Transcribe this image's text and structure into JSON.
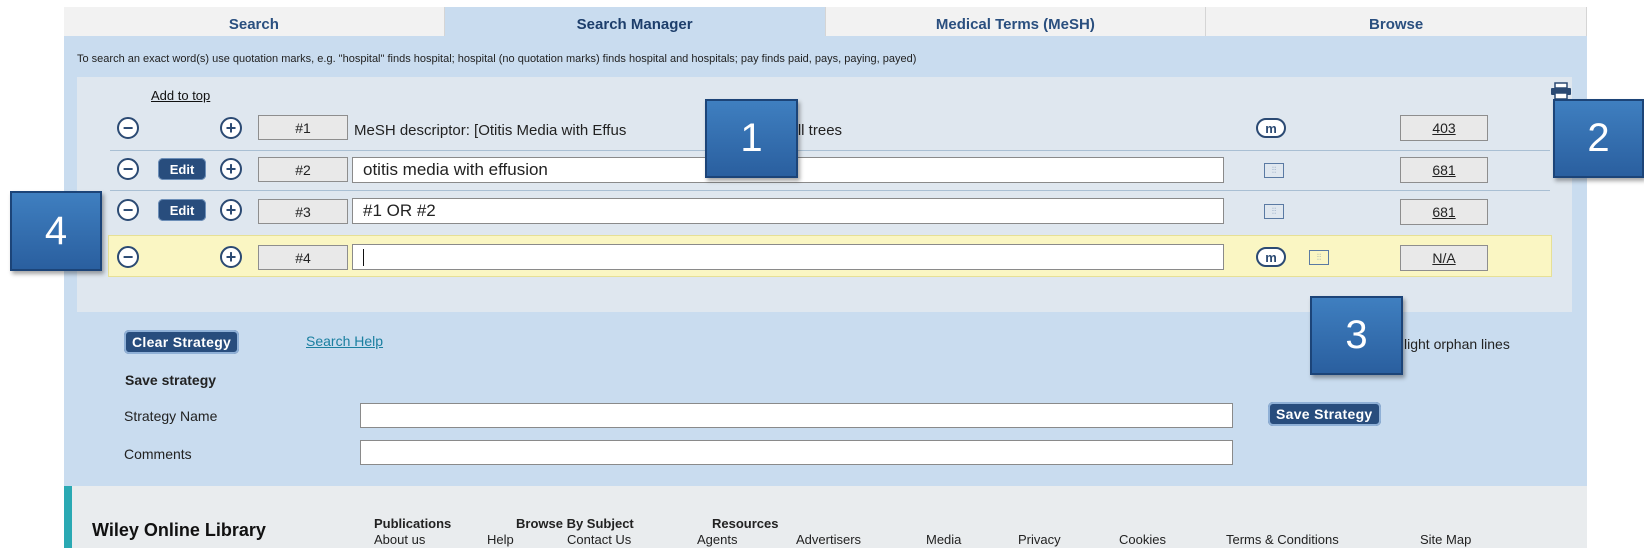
{
  "tabs": [
    {
      "label": "Search"
    },
    {
      "label": "Search Manager"
    },
    {
      "label": "Medical Terms (MeSH)"
    },
    {
      "label": "Browse"
    }
  ],
  "hint": "To search an exact word(s) use quotation marks, e.g. \"hospital\" finds hospital; hospital (no quotation marks) finds hospital and hospitals; pay finds paid, pays, paying, payed)",
  "add_to_top": "Add to top",
  "rows": [
    {
      "num": "#1",
      "text": "MeSH descriptor: [Otitis Media with Effus",
      "text2": "e all trees",
      "count": "403"
    },
    {
      "num": "#2",
      "edit": "Edit",
      "text": "otitis media with effusion",
      "count": "681"
    },
    {
      "num": "#3",
      "edit": "Edit",
      "text": "#1 OR #2",
      "count": "681"
    },
    {
      "num": "#4",
      "text": "",
      "count": "N/A"
    }
  ],
  "mesh_badge": "m",
  "buttons": {
    "clear_strategy": "Clear Strategy",
    "search_help": "Search Help",
    "save_strategy": "Save Strategy",
    "highlight_orphan": "light orphan lines"
  },
  "save": {
    "heading": "Save strategy",
    "name_label": "Strategy Name",
    "comments_label": "Comments"
  },
  "callouts": [
    "1",
    "2",
    "3",
    "4"
  ],
  "footer": {
    "logo": "Wiley Online Library",
    "top_links": [
      "Publications",
      "Browse By Subject",
      "Resources"
    ],
    "bottom_links": [
      "About us",
      "Help",
      "Contact Us",
      "Agents",
      "Advertisers",
      "Media",
      "Privacy",
      "Cookies",
      "Terms & Conditions",
      "Site Map"
    ]
  },
  "colors": {
    "accent": "#284d7d",
    "panel": "#c9dcef",
    "callout": "#2f6bb0",
    "highlight_row": "#faf6c3"
  }
}
